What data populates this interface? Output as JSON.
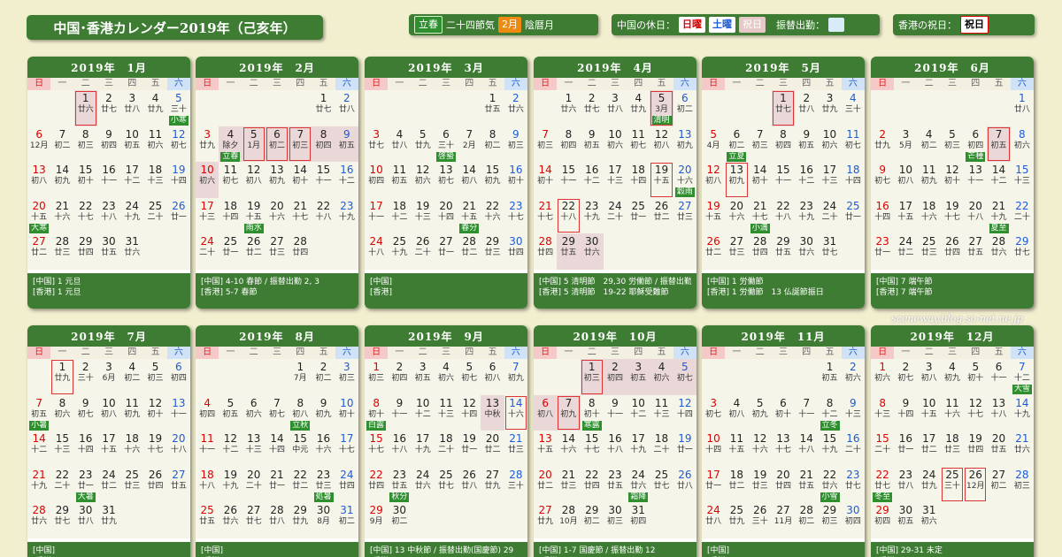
{
  "title": "中国･香港カレンダー2019年（己亥年）",
  "legend": {
    "risshun": "立春",
    "sekki": "二十四節気",
    "lunar_month": "2月",
    "lunar_label": "陰暦月",
    "cn_holiday_label": "中国の休日：",
    "sun": "日曜",
    "sat": "土曜",
    "holiday": "祝日",
    "makeup_label": "振替出勤：",
    "hk_label": "香港の祝日：",
    "hk_holiday": "祝日"
  },
  "weekdays": [
    "日",
    "一",
    "二",
    "三",
    "四",
    "五",
    "六"
  ],
  "credit": "sceneway.blog.so-net.ne.jp",
  "months": [
    {
      "header": "2019年　1月",
      "offset": 2,
      "days": 31,
      "footer": [
        "[中国] 1 元旦",
        "[香港] 1 元旦"
      ]
    },
    {
      "header": "2019年　2月",
      "offset": 5,
      "days": 28,
      "footer": [
        "[中国] 4-10 春節 / 振替出勤 2, 3",
        "[香港] 5-7 春節"
      ]
    },
    {
      "header": "2019年　3月",
      "offset": 5,
      "days": 31,
      "footer": [
        "[中国]",
        "[香港]"
      ]
    },
    {
      "header": "2019年　4月",
      "offset": 1,
      "days": 30,
      "footer": [
        "[中国] 5 清明節　29,30 労働節 / 振替出勤 27,28",
        "[香港] 5 清明節　19-22 耶穌受難節"
      ]
    },
    {
      "header": "2019年　5月",
      "offset": 3,
      "days": 31,
      "footer": [
        "[中国] 1 労働節",
        "[香港] 1 労働節　13 仏誕節振日"
      ]
    },
    {
      "header": "2019年　6月",
      "offset": 6,
      "days": 30,
      "footer": [
        "[中国] 7 端午節",
        "[香港] 7 端午節"
      ]
    },
    {
      "header": "2019年　7月",
      "offset": 1,
      "days": 31,
      "footer": [
        "[中国]",
        "[香港]"
      ]
    },
    {
      "header": "2019年　8月",
      "offset": 4,
      "days": 31,
      "footer": [
        "[中国]",
        "[香港]"
      ]
    },
    {
      "header": "2019年　9月",
      "offset": 0,
      "days": 30,
      "footer": [
        "[中国] 13 中秋節 / 振替出勤(国慶節) 29",
        "[香港]"
      ]
    },
    {
      "header": "2019年　10月",
      "offset": 2,
      "days": 31,
      "footer": [
        "[中国] 1-7 国慶節 / 振替出勤 12",
        "[香港]"
      ]
    },
    {
      "header": "2019年　11月",
      "offset": 5,
      "days": 30,
      "footer": [
        "[中国]",
        "[香港]"
      ]
    },
    {
      "header": "2019年　12月",
      "offset": 0,
      "days": 31,
      "footer": [
        "[中国] 29-31 未定",
        "[香港]"
      ]
    }
  ],
  "lunar": {
    "1": [
      "",
      "",
      "",
      "",
      "",
      "",
      "",
      "",
      "",
      "",
      "",
      "",
      "",
      "",
      "",
      "",
      "",
      "",
      "",
      "",
      "",
      "",
      "",
      "",
      "",
      "",
      "",
      "",
      "",
      "",
      "",
      ""
    ],
    "jan": [
      "廿六",
      "廿七",
      "廿八",
      "廿九",
      "三十",
      "12月",
      "初二",
      "初三",
      "初四",
      "初五",
      "初六",
      "初七",
      "初八",
      "初九",
      "初十",
      "十一",
      "十二",
      "十三",
      "十四",
      "十五",
      "十六",
      "十七",
      "十八",
      "十九",
      "二十",
      "廿一",
      "廿二",
      "廿三",
      "廿四",
      "廿五",
      "廿六"
    ],
    "feb": [
      "廿七",
      "廿八",
      "廿九",
      "除夕",
      "1月",
      "初二",
      "初三",
      "初四",
      "初五",
      "初六",
      "初七",
      "初八",
      "初九",
      "初十",
      "十一",
      "十二",
      "十三",
      "十四",
      "十五",
      "十六",
      "十七",
      "十八",
      "十九",
      "二十",
      "廿一",
      "廿二",
      "廿三",
      "廿四"
    ],
    "mar": [
      "廿五",
      "廿六",
      "廿七",
      "廿八",
      "廿九",
      "三十",
      "2月",
      "初二",
      "初三",
      "初四",
      "初五",
      "初六",
      "初七",
      "初八",
      "初九",
      "初十",
      "十一",
      "十二",
      "十三",
      "十四",
      "十五",
      "十六",
      "十七",
      "十八",
      "十九",
      "二十",
      "廿一",
      "廿二",
      "廿三",
      "廿四",
      "廿五"
    ],
    "apr": [
      "廿六",
      "廿七",
      "廿八",
      "廿九",
      "3月",
      "初二",
      "初三",
      "初四",
      "初五",
      "初六",
      "初七",
      "初八",
      "初九",
      "初十",
      "十一",
      "十二",
      "十三",
      "十四",
      "十五",
      "十六",
      "十七",
      "十八",
      "十九",
      "二十",
      "廿一",
      "廿二",
      "廿三",
      "廿四",
      "廿五",
      "廿六"
    ],
    "may": [
      "廿七",
      "廿八",
      "廿九",
      "三十",
      "4月",
      "初二",
      "初三",
      "初四",
      "初五",
      "初六",
      "初七",
      "初八",
      "初九",
      "初十",
      "十一",
      "十二",
      "十三",
      "十四",
      "十五",
      "十六",
      "十七",
      "十八",
      "十九",
      "二十",
      "廿一",
      "廿二",
      "廿三",
      "廿四",
      "廿五",
      "廿六",
      "廿七"
    ],
    "jun": [
      "廿八",
      "廿九",
      "5月",
      "初二",
      "初三",
      "初四",
      "初五",
      "初六",
      "初七",
      "初八",
      "初九",
      "初十",
      "十一",
      "十二",
      "十三",
      "十四",
      "十五",
      "十六",
      "十七",
      "十八",
      "十九",
      "二十",
      "廿一",
      "廿二",
      "廿三",
      "廿四",
      "廿五",
      "廿六",
      "廿七",
      "廿八"
    ],
    "jul": [
      "廿九",
      "三十",
      "6月",
      "初二",
      "初三",
      "初四",
      "初五",
      "初六",
      "初七",
      "初八",
      "初九",
      "初十",
      "十一",
      "十二",
      "十三",
      "十四",
      "十五",
      "十六",
      "十七",
      "十八",
      "十九",
      "二十",
      "廿一",
      "廿二",
      "廿三",
      "廿四",
      "廿五",
      "廿六",
      "廿七",
      "廿八",
      "廿九"
    ],
    "aug": [
      "7月",
      "初二",
      "初三",
      "初四",
      "初五",
      "初六",
      "初七",
      "初八",
      "初九",
      "初十",
      "十一",
      "十二",
      "十三",
      "十四",
      "中元",
      "十六",
      "十七",
      "十八",
      "十九",
      "二十",
      "廿一",
      "廿二",
      "廿三",
      "廿四",
      "廿五",
      "廿六",
      "廿七",
      "廿八",
      "廿九",
      "8月",
      "初二"
    ],
    "sep": [
      "初三",
      "初四",
      "初五",
      "初六",
      "初七",
      "初八",
      "初九",
      "初十",
      "十一",
      "十二",
      "十三",
      "十四",
      "中秋",
      "十六",
      "十七",
      "十八",
      "十九",
      "二十",
      "廿一",
      "廿二",
      "廿三",
      "廿四",
      "廿五",
      "廿六",
      "廿七",
      "廿八",
      "廿九",
      "三十",
      "9月",
      "初二"
    ],
    "oct": [
      "初三",
      "初四",
      "初五",
      "初六",
      "初七",
      "初八",
      "初九",
      "初十",
      "十一",
      "十二",
      "十三",
      "十四",
      "十五",
      "十六",
      "十七",
      "十八",
      "十九",
      "二十",
      "廿一",
      "廿二",
      "廿三",
      "廿四",
      "廿五",
      "廿六",
      "廿七",
      "廿八",
      "廿九",
      "10月",
      "初二",
      "初三",
      "初四"
    ],
    "nov": [
      "初五",
      "初六",
      "初七",
      "初八",
      "初九",
      "初十",
      "十一",
      "十二",
      "十三",
      "十四",
      "十五",
      "十六",
      "十七",
      "十八",
      "十九",
      "二十",
      "廿一",
      "廿二",
      "廿三",
      "廿四",
      "廿五",
      "廿六",
      "廿七",
      "廿八",
      "廿九",
      "三十",
      "11月",
      "初二",
      "初三",
      "初四"
    ],
    "dec": [
      "初六",
      "初七",
      "初八",
      "初九",
      "初十",
      "十一",
      "十二",
      "十三",
      "十四",
      "十五",
      "十六",
      "十七",
      "十八",
      "十九",
      "二十",
      "廿一",
      "廿二",
      "廿三",
      "廿四",
      "廿五",
      "廿六",
      "廿七",
      "廿八",
      "廿九",
      "三十",
      "12月",
      "初二",
      "初三",
      "初四",
      "初五",
      "初六"
    ]
  },
  "terms": {
    "jan": {
      "5": "小寒",
      "20": "大寒"
    },
    "feb": {
      "4": "立春",
      "19": "雨水"
    },
    "mar": {
      "6": "啓蟄",
      "21": "春分"
    },
    "apr": {
      "5": "清明",
      "20": "穀雨"
    },
    "may": {
      "6": "立夏",
      "21": "小満"
    },
    "jun": {
      "6": "芒種",
      "21": "夏至"
    },
    "jul": {
      "7": "小暑",
      "23": "大暑"
    },
    "aug": {
      "8": "立秋",
      "23": "処暑"
    },
    "sep": {
      "8": "白露",
      "23": "秋分"
    },
    "oct": {
      "8": "寒露",
      "24": "霜降"
    },
    "nov": {
      "8": "立冬",
      "22": "小雪"
    },
    "dec": {
      "7": "大雪",
      "22": "冬至"
    }
  },
  "holidays_cn": {
    "jan": [
      1
    ],
    "feb": [
      4,
      5,
      6,
      7,
      8,
      9,
      10
    ],
    "mar": [],
    "apr": [
      5,
      29,
      30
    ],
    "may": [
      1
    ],
    "jun": [
      7
    ],
    "jul": [],
    "aug": [],
    "sep": [
      13
    ],
    "oct": [
      1,
      2,
      3,
      4,
      5,
      6,
      7
    ],
    "nov": [],
    "dec": []
  },
  "holidays_hk": {
    "jan": [
      1
    ],
    "feb": [
      5,
      6,
      7
    ],
    "mar": [],
    "apr": [
      5,
      19,
      22
    ],
    "may": [
      1,
      13
    ],
    "jun": [
      7
    ],
    "jul": [
      1
    ],
    "aug": [],
    "sep": [
      14
    ],
    "oct": [
      1,
      7
    ],
    "nov": [],
    "dec": [
      25,
      26
    ]
  }
}
